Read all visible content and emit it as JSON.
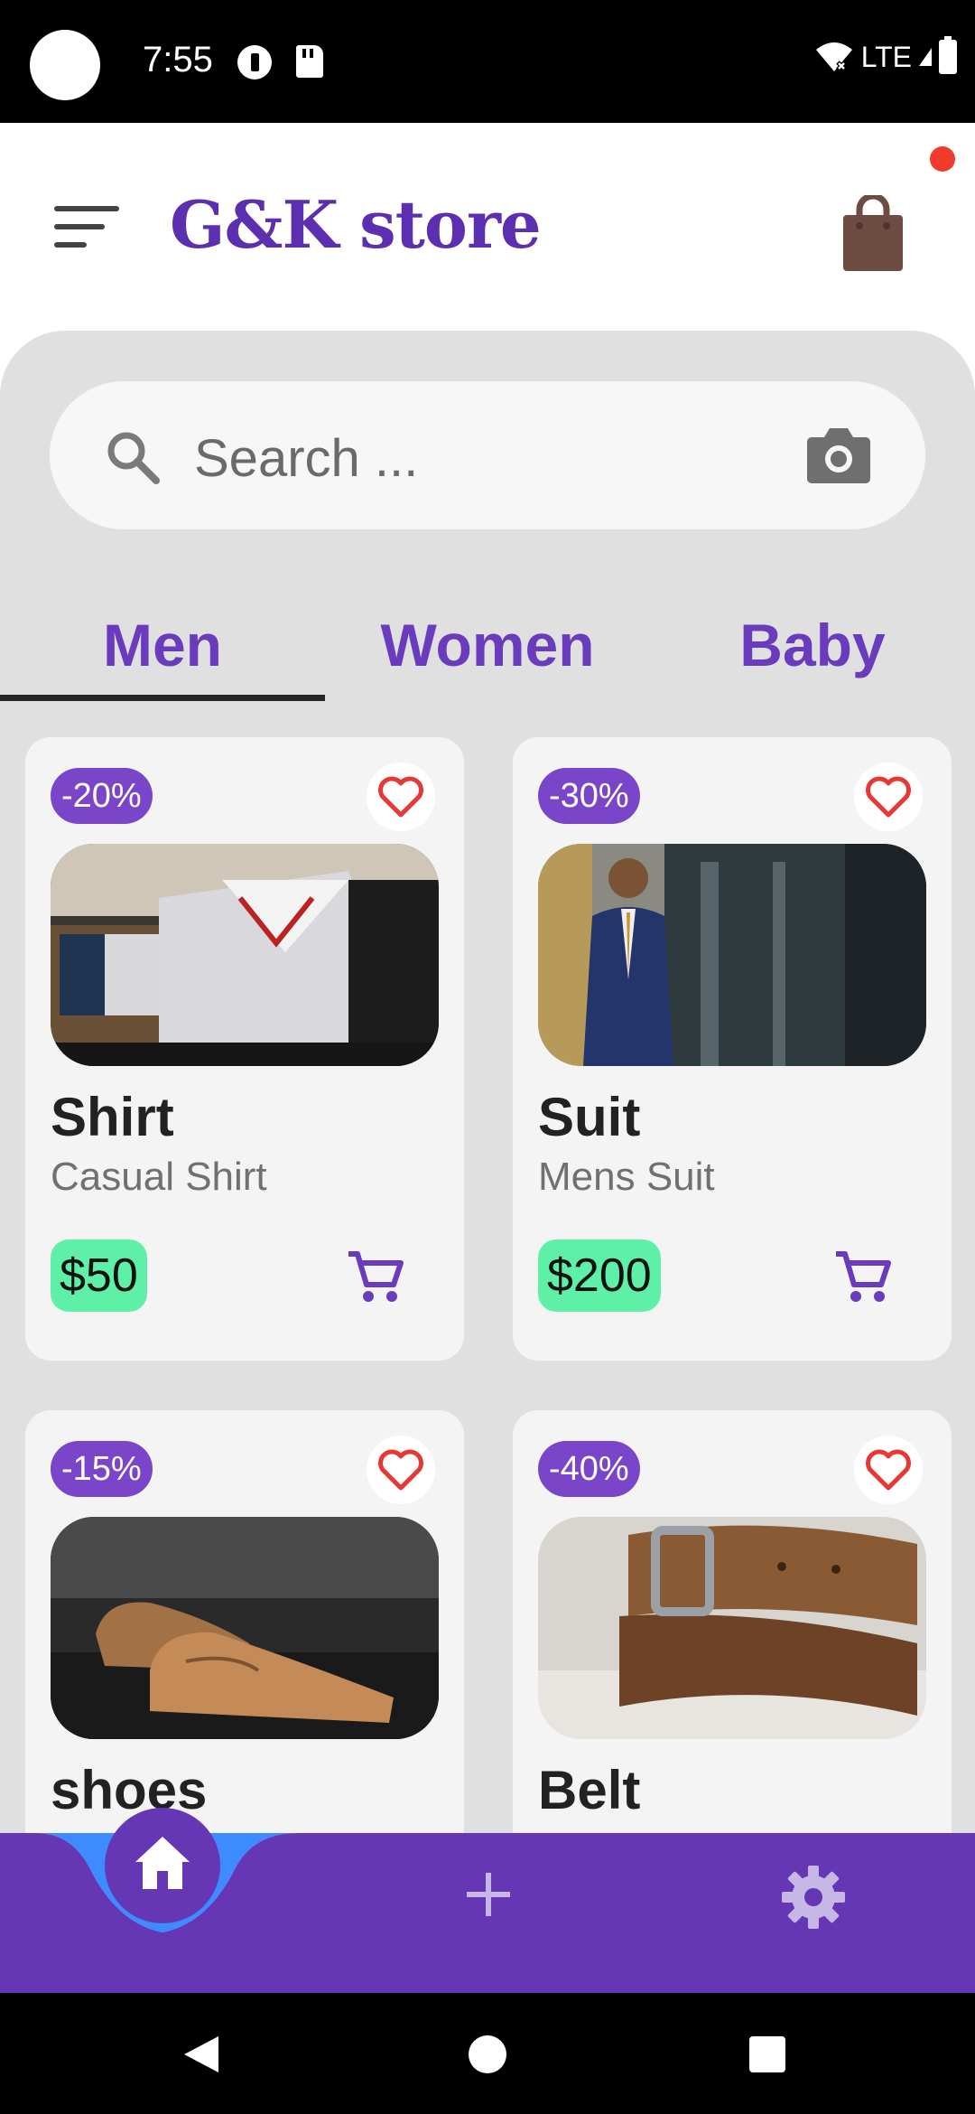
{
  "status_bar": {
    "time": "7:55",
    "network": "LTE",
    "icons": [
      "camera-hole",
      "data-saver-icon",
      "sd-card-icon",
      "wifi-off-icon",
      "signal-icon",
      "battery-icon"
    ]
  },
  "header": {
    "title": "G&K store",
    "menu_icon": "menu-icon",
    "cart_icon": "shopping-bag-icon",
    "has_notification": true
  },
  "search": {
    "placeholder": "Search ..."
  },
  "tabs": [
    {
      "label": "Men",
      "selected": true
    },
    {
      "label": "Women",
      "selected": false
    },
    {
      "label": "Baby",
      "selected": false
    }
  ],
  "products": [
    {
      "discount": "-20%",
      "name": "Shirt",
      "description": "Casual Shirt",
      "price": "$50"
    },
    {
      "discount": "-30%",
      "name": "Suit",
      "description": "Mens Suit",
      "price": "$200"
    },
    {
      "discount": "-15%",
      "name": "shoes",
      "description": "",
      "price": ""
    },
    {
      "discount": "-40%",
      "name": "Belt",
      "description": "",
      "price": ""
    }
  ],
  "bottom_nav": {
    "items": [
      "home-icon",
      "add-icon",
      "settings-icon"
    ],
    "active": "home"
  },
  "colors": {
    "primary": "#6637b5",
    "title": "#5b2fb0",
    "price_bg": "#5ef0a6",
    "heart": "#e53935",
    "nav_curve": "#3d8bff"
  }
}
